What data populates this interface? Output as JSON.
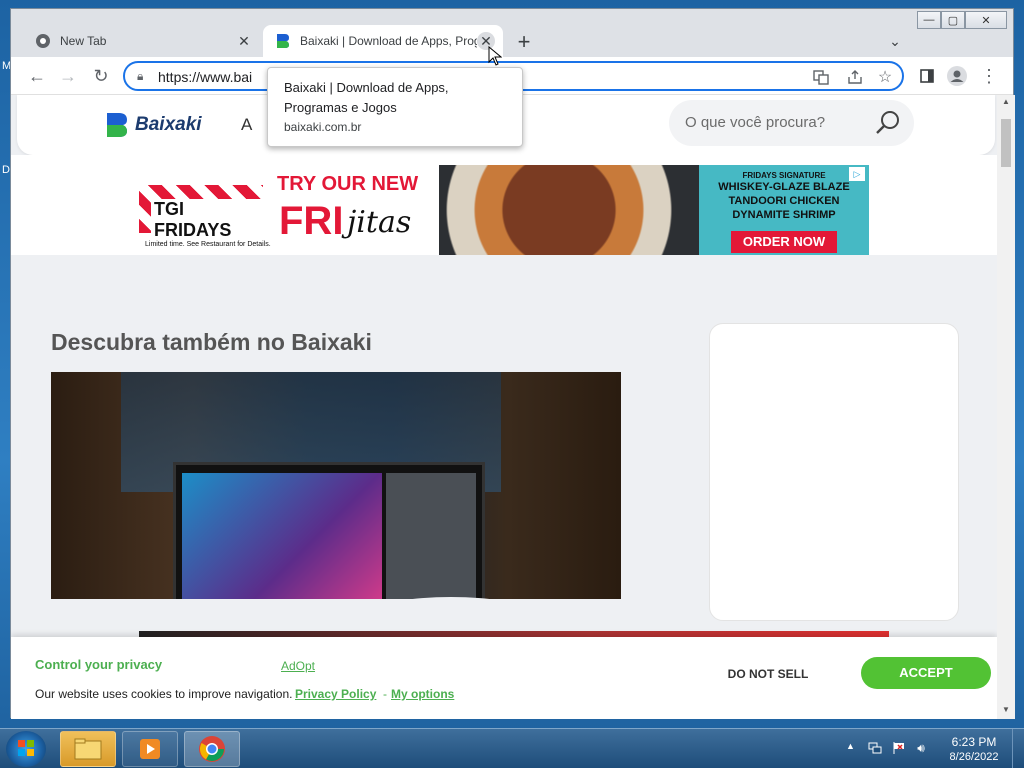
{
  "desktop": {
    "letter_top": "M",
    "letter_mid": "D"
  },
  "tabs": [
    {
      "title": "New Tab",
      "icon": "chrome-icon"
    },
    {
      "title": "Baixaki | Download de Apps, Programas e Jogos",
      "icon": "baixaki-favicon"
    }
  ],
  "window_controls": {
    "minimize": "—",
    "maximize": "▢",
    "close": "✕"
  },
  "toolbar": {
    "url": "https://www.bai"
  },
  "tooltip": {
    "title": "Baixaki | Download de Apps, Programas e Jogos",
    "url": "baixaki.com.br"
  },
  "site": {
    "logo_text": "Baixaki",
    "nav_fragment": "A",
    "search_placeholder": "O que você procura?",
    "section_title": "Descubra também no Baixaki"
  },
  "ad": {
    "brand": "TGI FRIDAYS",
    "fineprint": "Limited time. See Restaurant for Details.",
    "headline": "TRY OUR NEW",
    "fri": "FRI",
    "jitas": "jitas",
    "line1": "FRIDAYS SIGNATURE",
    "line2": "WHISKEY-GLAZE BLAZE",
    "line3": "TANDOORI CHICKEN",
    "line4": "DYNAMITE SHRIMP",
    "order": "ORDER NOW"
  },
  "cookie": {
    "title": "Control your privacy",
    "brand": "AdOpt",
    "text": "Our website uses cookies to improve navigation.",
    "privacy_link": "Privacy Policy",
    "separator": "-",
    "options_link": "My options",
    "do_not_sell": "DO NOT SELL",
    "accept": "ACCEPT"
  },
  "taskbar": {
    "time": "6:23 PM",
    "date": "8/26/2022"
  },
  "colors": {
    "accent": "#1a73e8",
    "cookie_green": "#4caf50",
    "accept_green": "#52c234",
    "brand_blue": "#1c3b6e",
    "ad_red": "#e31837"
  }
}
